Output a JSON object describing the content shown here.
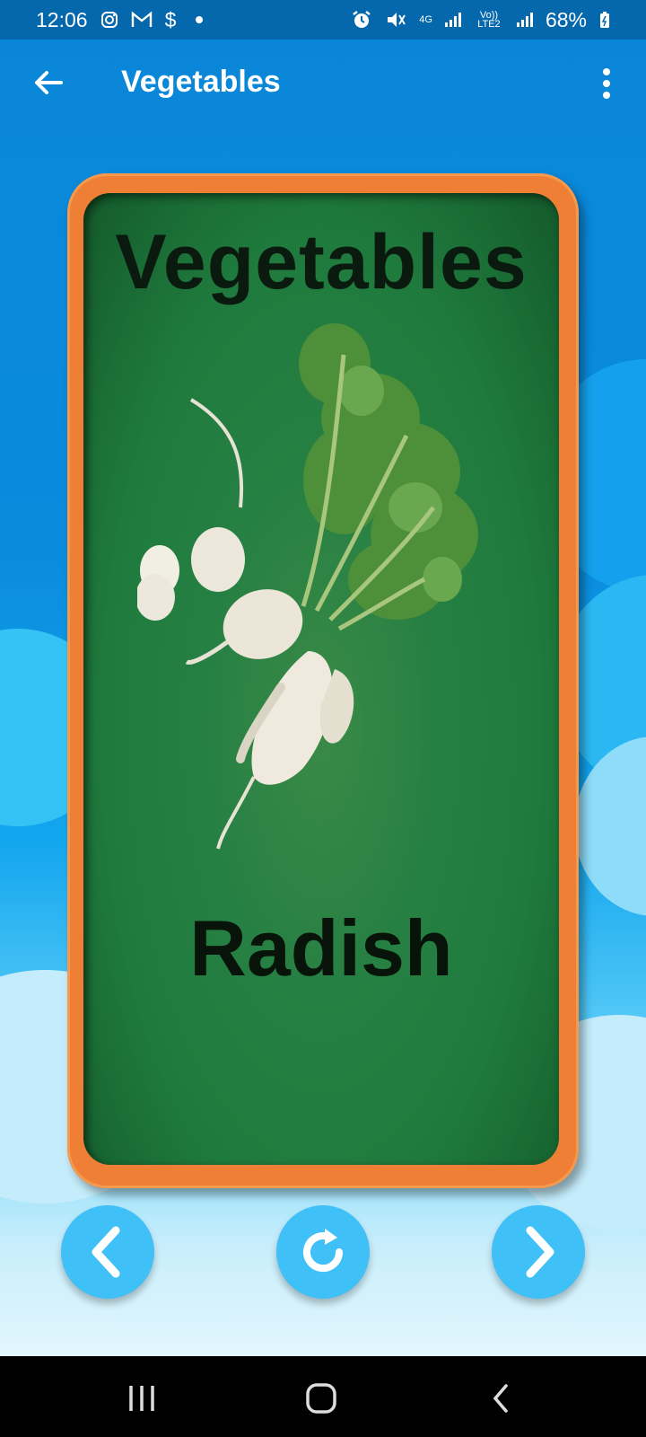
{
  "status_bar": {
    "time": "12:06",
    "notification_icons": [
      "instagram-icon",
      "gmail-icon",
      "dollar-icon",
      "dot-icon"
    ],
    "network_label": "4G",
    "volte_label": "Vo)) LTE2",
    "battery": "68%"
  },
  "app_bar": {
    "title": "Vegetables",
    "back_icon": "arrow-left-icon",
    "menu_icon": "more-vert-icon"
  },
  "card": {
    "heading": "Vegetables",
    "word": "Radish",
    "image": "radish-illustration"
  },
  "controls": {
    "previous_icon": "chevron-left-icon",
    "replay_icon": "replay-icon",
    "next_icon": "chevron-right-icon"
  },
  "system_nav": {
    "recents_icon": "recents-icon",
    "home_icon": "home-icon",
    "back_icon": "back-icon"
  },
  "colors": {
    "status_bar": "#0568ad",
    "app_bar": "#0a86d8",
    "card_frame": "#ef7f34",
    "card_background": "#268043",
    "control_button": "#3fc0f6"
  }
}
